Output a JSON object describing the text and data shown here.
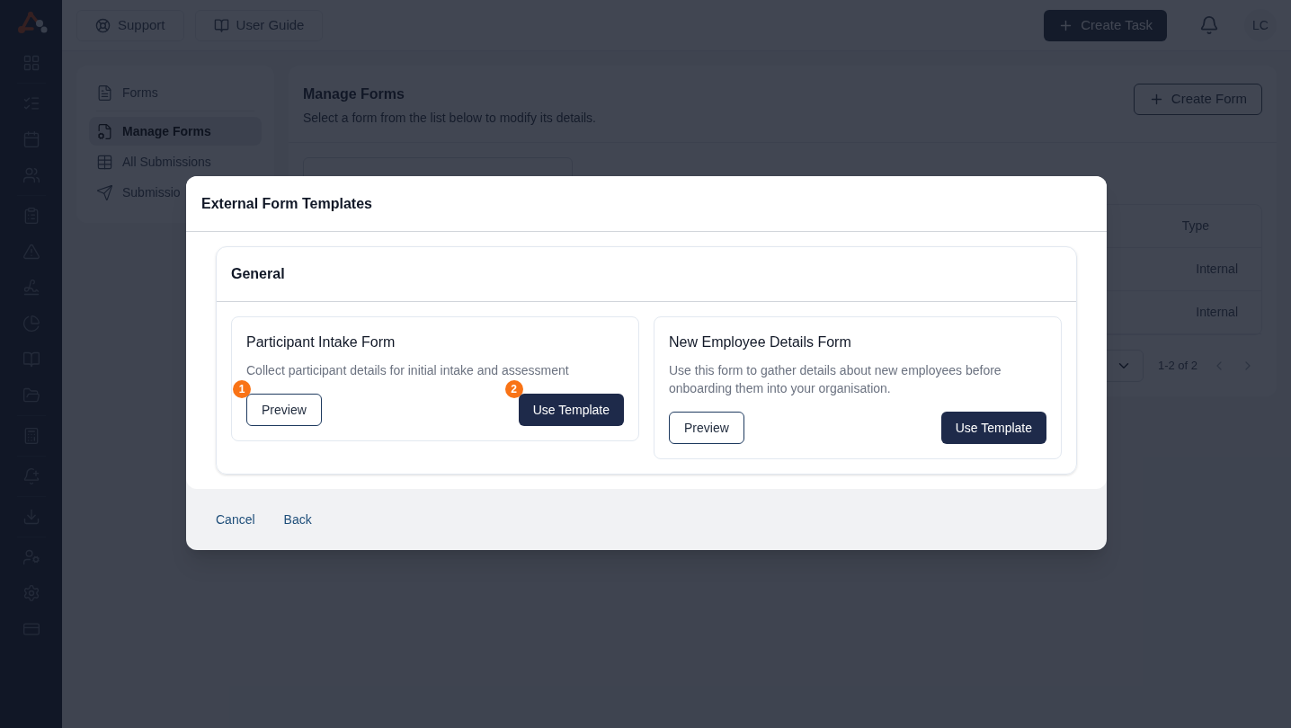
{
  "topbar": {
    "buttons": [
      {
        "kind": "support",
        "label": "Support"
      },
      {
        "kind": "guide",
        "label": "User Guide"
      }
    ],
    "create_button": "Create Task",
    "avatar": "LC"
  },
  "forms_nav": {
    "items": [
      {
        "kind": "forms",
        "label": "Forms",
        "selected": false
      },
      {
        "kind": "manage",
        "label": "Manage Forms",
        "selected": true
      },
      {
        "kind": "submissions",
        "label": "All Submissions",
        "selected": false
      },
      {
        "kind": "send",
        "label": "Submissio",
        "selected": false
      }
    ]
  },
  "manage_forms": {
    "title": "Manage Forms",
    "subtitle": "Select a form from the list below to modify its details.",
    "create_button": "Create Form",
    "table": {
      "columns": [
        "Type"
      ],
      "rows": [
        [
          "Internal"
        ],
        [
          "Internal"
        ]
      ]
    },
    "pagination": "1-2 of 2"
  },
  "modal": {
    "title": "External Form Templates",
    "section": "General",
    "templates": [
      {
        "title": "Participant Intake Form",
        "description": "Collect participant details for initial intake and assessment",
        "preview": {
          "label": "Preview",
          "marker": "1"
        },
        "use": {
          "label": "Use Template",
          "marker": "2"
        }
      },
      {
        "title": "New Employee Details Form",
        "description": "Use this form to gather details about new employees before onboarding them into your organisation.",
        "preview": {
          "label": "Preview"
        },
        "use": {
          "label": "Use Template"
        }
      }
    ],
    "footer": [
      "Cancel",
      "Back"
    ]
  }
}
